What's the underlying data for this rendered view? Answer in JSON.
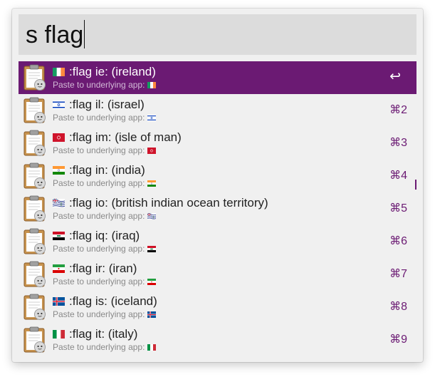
{
  "search": {
    "query": "s flag"
  },
  "results": [
    {
      "title": ":flag ie: (ireland)",
      "subtitle": "Paste to underlying app:",
      "shortcut": "↩",
      "flag": "ireland",
      "selected": true
    },
    {
      "title": ":flag il: (israel)",
      "subtitle": "Paste to underlying app:",
      "shortcut": "⌘2",
      "flag": "israel"
    },
    {
      "title": ":flag im: (isle of man)",
      "subtitle": "Paste to underlying app:",
      "shortcut": "⌘3",
      "flag": "isle-of-man"
    },
    {
      "title": ":flag in: (india)",
      "subtitle": "Paste to underlying app:",
      "shortcut": "⌘4",
      "flag": "india"
    },
    {
      "title": ":flag io: (british indian ocean territory)",
      "subtitle": "Paste to underlying app:",
      "shortcut": "⌘5",
      "flag": "british-indian-ocean-territory"
    },
    {
      "title": ":flag iq: (iraq)",
      "subtitle": "Paste to underlying app:",
      "shortcut": "⌘6",
      "flag": "iraq"
    },
    {
      "title": ":flag ir: (iran)",
      "subtitle": "Paste to underlying app:",
      "shortcut": "⌘7",
      "flag": "iran"
    },
    {
      "title": ":flag is: (iceland)",
      "subtitle": "Paste to underlying app:",
      "shortcut": "⌘8",
      "flag": "iceland"
    },
    {
      "title": ":flag it: (italy)",
      "subtitle": "Paste to underlying app:",
      "shortcut": "⌘9",
      "flag": "italy"
    }
  ],
  "icons": {
    "result_icon": "clipboard-icon"
  },
  "colors": {
    "accent": "#6b1a73",
    "selected_text": "#ffffff",
    "search_bg": "#dcdcdc",
    "window_bg": "#f0f0f0"
  }
}
